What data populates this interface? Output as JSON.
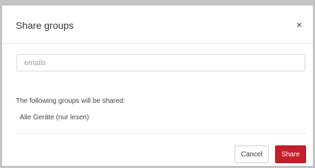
{
  "dialog": {
    "title": "Share groups",
    "close_glyph": "×",
    "close_icon": "close-icon"
  },
  "emails": {
    "placeholder": "emails",
    "value": ""
  },
  "groups": {
    "label": "The following groups will be shared:",
    "items": [
      {
        "bullet": "·",
        "label": "Alle Geräte (nur lesen)"
      }
    ]
  },
  "footer": {
    "cancel_label": "Cancel",
    "share_label": "Share"
  },
  "colors": {
    "primary": "#c41f2a",
    "backdrop": "#c4c4c4"
  }
}
